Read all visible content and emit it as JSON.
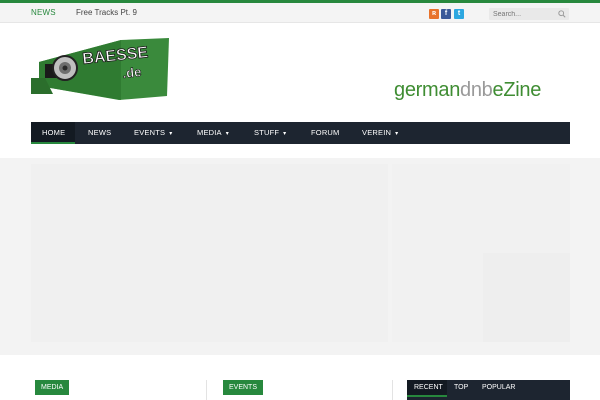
{
  "topbar": {
    "news_label": "NEWS",
    "ticker_text": "Free Tracks Pt. 9",
    "social": [
      {
        "icon": "rss-icon",
        "glyph": "ʀ",
        "color": "#e8722b"
      },
      {
        "icon": "facebook-icon",
        "glyph": "f",
        "color": "#3b5998"
      },
      {
        "icon": "twitter-icon",
        "glyph": "t",
        "color": "#2da7e0"
      }
    ],
    "search_placeholder": "Search..."
  },
  "header": {
    "logo_text": "BAESSE",
    "logo_sub": ".de",
    "ezine_part1": "german",
    "ezine_part2": "dnb",
    "ezine_part3": "eZine"
  },
  "nav": {
    "items": [
      {
        "label": "HOME",
        "active": true
      },
      {
        "label": "NEWS"
      },
      {
        "label": "EVENTS",
        "dropdown": true
      },
      {
        "label": "MEDIA",
        "dropdown": true
      },
      {
        "label": "STUFF",
        "dropdown": true
      },
      {
        "label": "FORUM"
      },
      {
        "label": "VEREIN",
        "dropdown": true
      }
    ],
    "chevron": "▾"
  },
  "blocks": {
    "media_label": "MEDIA",
    "events_label": "EVENTS",
    "tabs": [
      {
        "label": "RECENT",
        "active": true
      },
      {
        "label": "TOP"
      },
      {
        "label": "POPULAR"
      }
    ]
  },
  "colors": {
    "accent": "#27883d",
    "nav_bg": "#1d2530",
    "ezine_green": "#3f8d33",
    "ezine_grey": "#9a9a9a"
  }
}
